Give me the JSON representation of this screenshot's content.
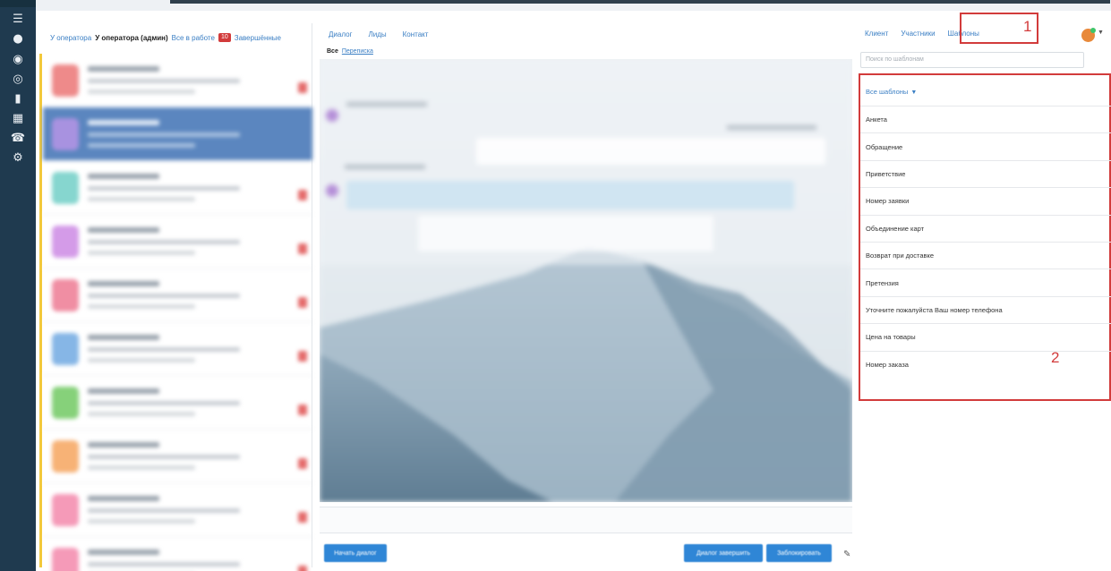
{
  "iconbar": {
    "icons": [
      "menu-icon",
      "chat-icon",
      "clock-icon",
      "message-circle-icon",
      "document-icon",
      "table-icon",
      "users-icon",
      "settings-icon"
    ]
  },
  "chat_list": {
    "filters": {
      "by_operator": "У оператора",
      "for_me": "У оператора (админ)",
      "all_work": "Все в работе",
      "all_work_count": "10",
      "favorites": "Завершённые"
    },
    "rows": [
      {
        "avatar_color": "#ee8a8a",
        "active": false
      },
      {
        "avatar_color": "#a892e0",
        "active": true
      },
      {
        "avatar_color": "#86d6cf",
        "active": false
      },
      {
        "avatar_color": "#d49be8",
        "active": false
      },
      {
        "avatar_color": "#f08ea3",
        "active": false
      },
      {
        "avatar_color": "#86b6e6",
        "active": false
      },
      {
        "avatar_color": "#86d17a",
        "active": false
      },
      {
        "avatar_color": "#f7b276",
        "active": false
      },
      {
        "avatar_color": "#f59ab8",
        "active": false
      },
      {
        "avatar_color": "#f59ab8",
        "active": false
      }
    ]
  },
  "dialog": {
    "tabs": [
      "Диалог",
      "Лиды",
      "Контакт"
    ],
    "subtabs": {
      "all": "Все",
      "link": "Переписка"
    },
    "buttons": {
      "new_dialog": "Начать диалог",
      "close_dialog": "Диалог завершить",
      "block": "Заблокировать"
    },
    "attach_icon": "paperclip-icon"
  },
  "right_panel": {
    "tabs": [
      "Клиент",
      "Участники",
      "Шаблоны"
    ],
    "active_tab": "Шаблоны",
    "callout_1": "1",
    "callout_2": "2",
    "search_placeholder": "Поиск по шаблонам",
    "dropdown_label": "Все шаблоны",
    "templates": [
      "Анкета",
      "Обращение",
      "Приветствие",
      "Номер заявки",
      "Объединение карт",
      "Возврат при доставке",
      "Претензия",
      "Уточните пожалуйста Ваш номер телефона",
      "Цена на товары",
      "Номер заказа"
    ]
  },
  "colors": {
    "sidebar": "#1f3a4f",
    "accent_blue": "#2f86d6",
    "link_blue": "#3b7fc4",
    "callout_red": "#d23b3b",
    "active_row": "#5b86bf"
  }
}
